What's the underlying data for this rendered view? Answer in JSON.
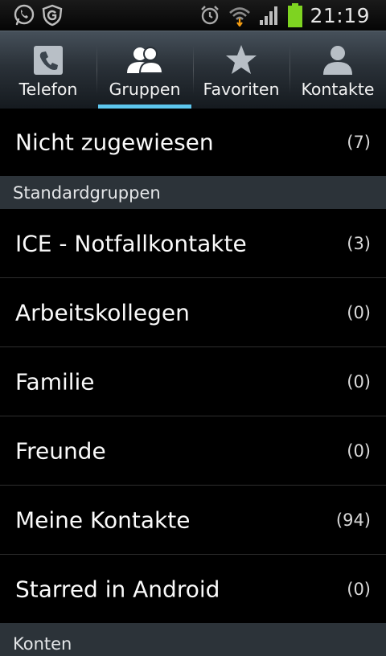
{
  "status_bar": {
    "time": "21:19",
    "left_icons": [
      "whatsapp-icon",
      "shield-g-icon"
    ],
    "right_icons": [
      "alarm-icon",
      "wifi-icon",
      "signal-icon",
      "battery-icon"
    ],
    "battery_level": 1.0,
    "battery_color": "#7ed321"
  },
  "tabs": [
    {
      "label": "Telefon",
      "icon": "phone-icon",
      "active": false
    },
    {
      "label": "Gruppen",
      "icon": "groups-icon",
      "active": true
    },
    {
      "label": "Favoriten",
      "icon": "star-icon",
      "active": false
    },
    {
      "label": "Kontakte",
      "icon": "contact-icon",
      "active": false
    }
  ],
  "accent_color": "#5dc7ee",
  "list": {
    "unassigned": {
      "label": "Nicht zugewiesen",
      "count": "(7)"
    },
    "sections": [
      {
        "title": "Standardgruppen",
        "items": [
          {
            "label": "ICE - Notfallkontakte",
            "count": "(3)"
          },
          {
            "label": "Arbeitskollegen",
            "count": "(0)"
          },
          {
            "label": "Familie",
            "count": "(0)"
          },
          {
            "label": "Freunde",
            "count": "(0)"
          },
          {
            "label": "Meine Kontakte",
            "count": "(94)"
          },
          {
            "label": "Starred in Android",
            "count": "(0)"
          }
        ]
      },
      {
        "title": "Konten",
        "items": []
      }
    ]
  }
}
